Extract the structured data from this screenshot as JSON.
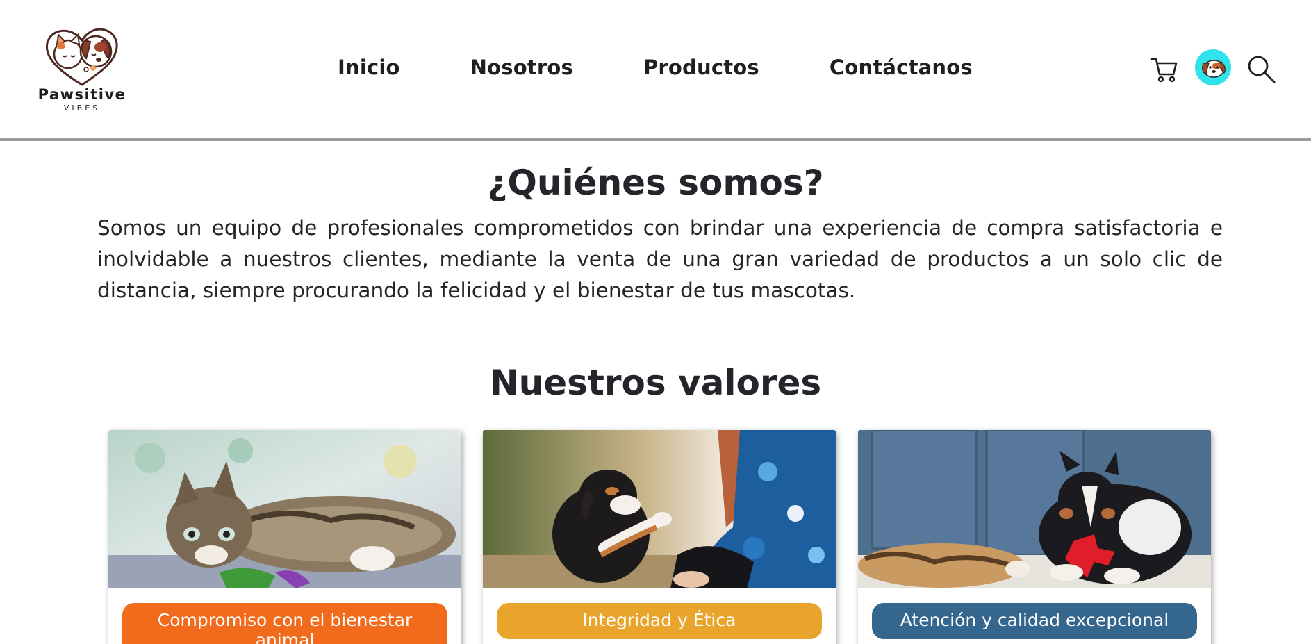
{
  "brand": {
    "name": "Pawsitive",
    "tagline": "VIBES"
  },
  "nav": {
    "items": [
      {
        "label": "Inicio"
      },
      {
        "label": "Nosotros"
      },
      {
        "label": "Productos"
      },
      {
        "label": "Contáctanos"
      }
    ]
  },
  "header_icons": {
    "cart": "cart-icon",
    "profile": "avatar",
    "search": "search-icon"
  },
  "about": {
    "title": "¿Quiénes somos?",
    "text": "Somos un equipo de profesionales comprometidos con brindar una experiencia de compra satisfactoria e inolvidable a nuestros clientes, mediante la venta de una gran variedad de productos a un solo clic de distancia, siempre procurando la felicidad y el bienestar de tus mascotas."
  },
  "values": {
    "title": "Nuestros valores",
    "cards": [
      {
        "label": "Compromiso con el bienestar animal",
        "color": "#f26a1c"
      },
      {
        "label": "Integridad y Ética",
        "color": "#e9a52b"
      },
      {
        "label": "Atención y calidad excepcional",
        "color": "#35668e"
      }
    ]
  },
  "colors": {
    "text": "#24252a",
    "header_border": "#9a9a9a",
    "avatar_bg": "#2ee3ea"
  }
}
